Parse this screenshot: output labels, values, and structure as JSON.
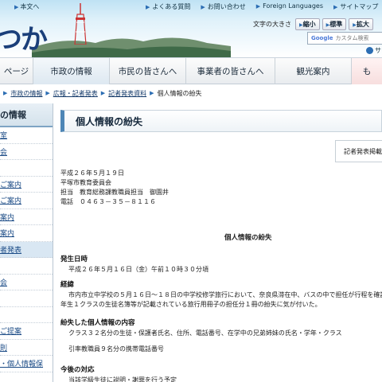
{
  "header": {
    "logo_text": "つか",
    "skip_link": "本文へ",
    "util_links": [
      "よくある質問",
      "お問い合わせ",
      "Foreign Languages",
      "サイトマップ"
    ],
    "font_size_label": "文字の大きさ",
    "font_size_buttons": [
      "縮小",
      "標準",
      "拡大"
    ],
    "search_placeholder": "カスタム検索",
    "search_brand": "Google",
    "search_button": "サ"
  },
  "gnav": {
    "items": [
      {
        "label": "ページ"
      },
      {
        "label": "市政の情報"
      },
      {
        "label": "市民の皆さんへ"
      },
      {
        "label": "事業者の皆さんへ"
      },
      {
        "label": "観光案内"
      },
      {
        "label": "も"
      }
    ]
  },
  "breadcrumb": {
    "items": [
      "市政の情報",
      "広報・記者発表",
      "記者発表資料"
    ],
    "current": "個人情報の紛失"
  },
  "sidebar": {
    "title": "の情報",
    "items": [
      "室",
      "会",
      "",
      "ご案内",
      "ご案内",
      "案内",
      "案内",
      "者発表",
      "",
      "会",
      "",
      "",
      "ご提案",
      "則",
      "・個人情報保"
    ]
  },
  "main": {
    "title": "個人情報の紛失",
    "press_box": "記者発表掲載",
    "meta": [
      "平成２６年５月１９日",
      "平塚市教育委員会",
      "担当　教育総務課教職員担当　御園井",
      "電話　０４６３－３５－８１１６"
    ],
    "doc_title": "個人情報の紛失",
    "sections": [
      {
        "heading": "発生日時",
        "lines": [
          "平成２６年５月１６日（金）午前１０時３０分頃"
        ]
      },
      {
        "heading": "経緯",
        "lines": [
          "市内市立中学校の５月１６日～１８日の中学校修学旅行において、奈良県滞在中、バスの中で担任が行程を確認しよ",
          "年生１クラスの生徒名簿等が記載されている旅行用冊子の担任分１冊の紛失に気が付いた。"
        ]
      },
      {
        "heading": "紛失した個人情報の内容",
        "lines": [
          "クラス３２名分の生徒・保護者氏名、住所、電話番号、在学中の兄弟姉妹の氏名・学年・クラス",
          "",
          "引率教職員９名分の携帯電話番号"
        ]
      },
      {
        "heading": "今後の対応",
        "lines": [
          "当該学級生徒に説明・謝罪を行う予定"
        ]
      }
    ]
  },
  "colors": {
    "accent": "#4e86b6",
    "link": "#1b4b86",
    "header_sky": "#bfe2f4"
  }
}
